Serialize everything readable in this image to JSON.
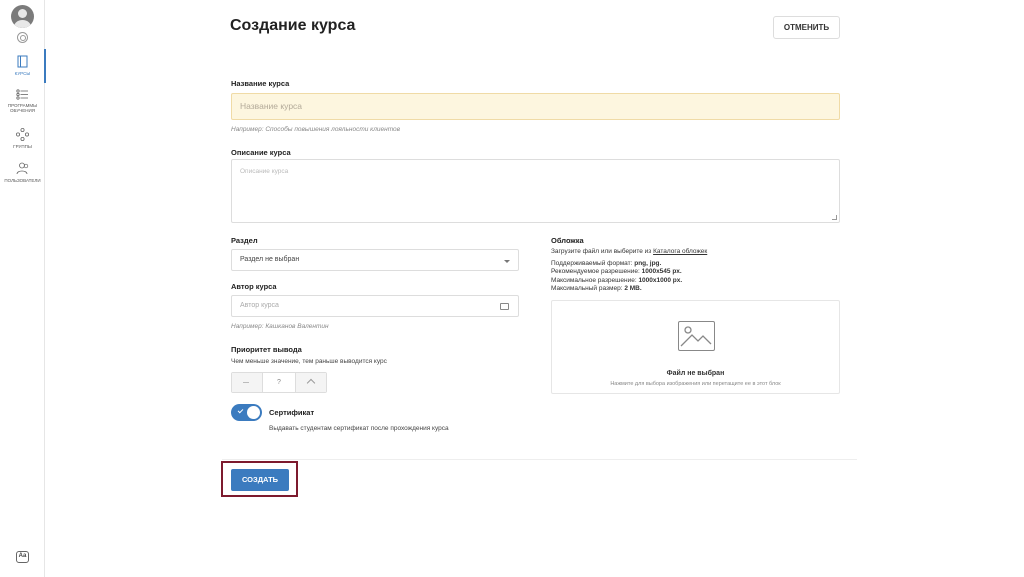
{
  "sidebar": {
    "items": [
      {
        "label": "Курсы",
        "icon": "book-icon",
        "active": true
      },
      {
        "label": "Программы обучения",
        "icon": "list-icon",
        "active": false
      },
      {
        "label": "Группы",
        "icon": "groups-icon",
        "active": false
      },
      {
        "label": "Пользователи",
        "icon": "users-icon",
        "active": false
      }
    ],
    "lang_label": "Aa"
  },
  "header": {
    "title": "Создание курса",
    "cancel_label": "ОТМЕНИТЬ"
  },
  "form": {
    "name": {
      "label": "Название курса",
      "placeholder": "Название курса",
      "hint": "Например: Способы повышения лояльности клиентов"
    },
    "description": {
      "label": "Описание курса",
      "placeholder": "Описание курса"
    },
    "section": {
      "label": "Раздел",
      "value": "Раздел не выбран"
    },
    "author": {
      "label": "Автор курса",
      "placeholder": "Автор курса",
      "hint": "Например: Кашканов Валентин"
    },
    "priority": {
      "label": "Приоритет вывода",
      "note": "Чем меньше значение, тем раньше выводится курс",
      "value": "?"
    },
    "certificate": {
      "label": "Сертификат",
      "note": "Выдавать студентам сертификат после прохождения курса",
      "enabled": true
    }
  },
  "cover": {
    "label": "Обложка",
    "upload_text": "Загрузите файл или выберите из ",
    "catalog_link": "Каталога обложек",
    "format_label": "Поддерживаемый формат: ",
    "format_value": "png, jpg.",
    "recommended_label": "Рекомендуемое разрешение: ",
    "recommended_value": "1000x545 px.",
    "max_res_label": "Максимальное разрешение: ",
    "max_res_value": "1000x1000 px.",
    "max_size_label": "Максимальный размер: ",
    "max_size_value": "2 MB.",
    "dropzone_title": "Файл не выбран",
    "dropzone_sub": "Нажмите для выбора изображения или перетащите ее в этот блок"
  },
  "actions": {
    "create_label": "СОЗДАТЬ"
  },
  "colors": {
    "accent": "#3b7bbf",
    "highlight_frame": "#7d1a2e",
    "input_highlight": "#fdf6df"
  }
}
